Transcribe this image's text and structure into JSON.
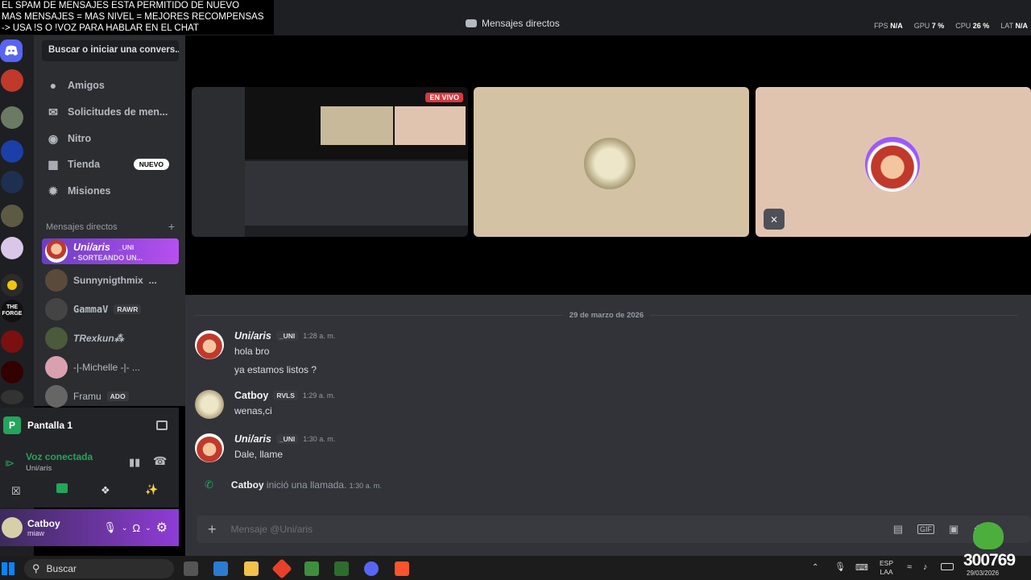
{
  "overlay": {
    "line1": "EL SPAM DE MENSAJES ESTA PERMITIDO DE NUEVO",
    "line2": "MAS MENSAJES = MAS NIVEL = MEJORES RECOMPENSAS",
    "line3": "-> USA !S  O !VOZ PARA HABLAR EN EL CHAT"
  },
  "window": {
    "title": "Mensajes directos"
  },
  "stats": {
    "fps_label": "FPS",
    "fps": "N/A",
    "gpu_label": "GPU",
    "gpu": "7 %",
    "cpu_label": "CPU",
    "cpu": "26 %",
    "lat_label": "LAT",
    "lat": "N/A"
  },
  "sidebar": {
    "search": "Buscar o iniciar una convers...",
    "nav": [
      {
        "label": "Amigos"
      },
      {
        "label": "Solicitudes de men..."
      },
      {
        "label": "Nitro"
      },
      {
        "label": "Tienda",
        "badge": "NUEVO"
      },
      {
        "label": "Misiones"
      }
    ],
    "dm_header": "Mensajes directos",
    "dm_add": "+",
    "dms": [
      {
        "name": "Uni/aris",
        "tag": "_UNI",
        "sub": "• SORTEANDO UN..."
      },
      {
        "name": "Sunnynigthmix",
        "extra": "..."
      },
      {
        "name": "GammaV",
        "tag": "RAWR"
      },
      {
        "name": "TRexkun⁂"
      },
      {
        "name": "-|-Michelle -|- ..."
      },
      {
        "name": "Framu",
        "tag": "ADO"
      }
    ]
  },
  "rail": {
    "forge_label": "THE FORGE"
  },
  "share": {
    "label": "Pantalla 1",
    "icon": "P"
  },
  "voice": {
    "status": "Voz conectada",
    "channel": "Uni/aris"
  },
  "user": {
    "name": "Catboy",
    "status": "miaw"
  },
  "video": {
    "live_badge": "EN VIVO"
  },
  "chat": {
    "date": "29 de marzo de 2026",
    "messages": [
      {
        "author": "Uni/aris",
        "tag": "_UNI",
        "time": "1:28 a. m.",
        "lines": [
          "hola bro",
          "ya estamos listos ?"
        ]
      },
      {
        "author": "Catboy",
        "tag": "RVLS",
        "time": "1:29 a. m.",
        "lines": [
          "wenas,ci"
        ]
      },
      {
        "author": "Uni/aris",
        "tag": "_UNI",
        "time": "1:30 a. m.",
        "lines": [
          "Dale, llame"
        ]
      }
    ],
    "call": {
      "author": "Catboy",
      "text": "inició una llamada.",
      "time": "1:30 a. m."
    },
    "composer_placeholder": "Mensaje @Uni/aris"
  },
  "taskbar": {
    "search": "Buscar",
    "lang1": "ESP",
    "lang2": "LAA",
    "date": "29/03/2026",
    "stream_counter": "300769"
  },
  "colors": {
    "blurple": "#5865f2",
    "green": "#23a55a",
    "purple": "#8f3cd6"
  }
}
